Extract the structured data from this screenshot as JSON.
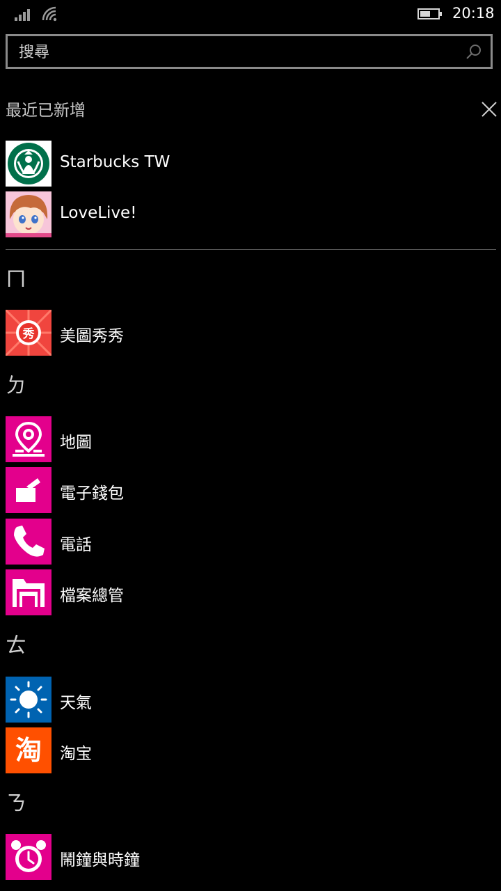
{
  "status_bar": {
    "time": "20:18"
  },
  "search": {
    "placeholder": "搜尋"
  },
  "recent": {
    "title": "最近已新增",
    "apps": [
      {
        "label": "Starbucks TW",
        "icon": "starbucks-logo"
      },
      {
        "label": "LoveLive!",
        "icon": "anime-avatar"
      }
    ]
  },
  "groups": [
    {
      "letter": "ㄇ",
      "apps": [
        {
          "label": "美圖秀秀",
          "icon": "meitu-icon",
          "color": "#f0453e"
        }
      ]
    },
    {
      "letter": "ㄉ",
      "apps": [
        {
          "label": "地圖",
          "icon": "map-pin-icon",
          "color": "#e3008c"
        },
        {
          "label": "電子錢包",
          "icon": "wallet-icon",
          "color": "#e3008c"
        },
        {
          "label": "電話",
          "icon": "phone-icon",
          "color": "#e3008c"
        },
        {
          "label": "檔案總管",
          "icon": "folder-icon",
          "color": "#e3008c"
        }
      ]
    },
    {
      "letter": "ㄊ",
      "apps": [
        {
          "label": "天氣",
          "icon": "sun-icon",
          "color": "#0063b1"
        },
        {
          "label": "淘宝",
          "icon": "taobao-icon",
          "color": "#ff5000"
        }
      ]
    },
    {
      "letter": "ㄋ",
      "apps": [
        {
          "label": "鬧鐘與時鐘",
          "icon": "alarm-clock-icon",
          "color": "#e3008c"
        }
      ]
    }
  ]
}
